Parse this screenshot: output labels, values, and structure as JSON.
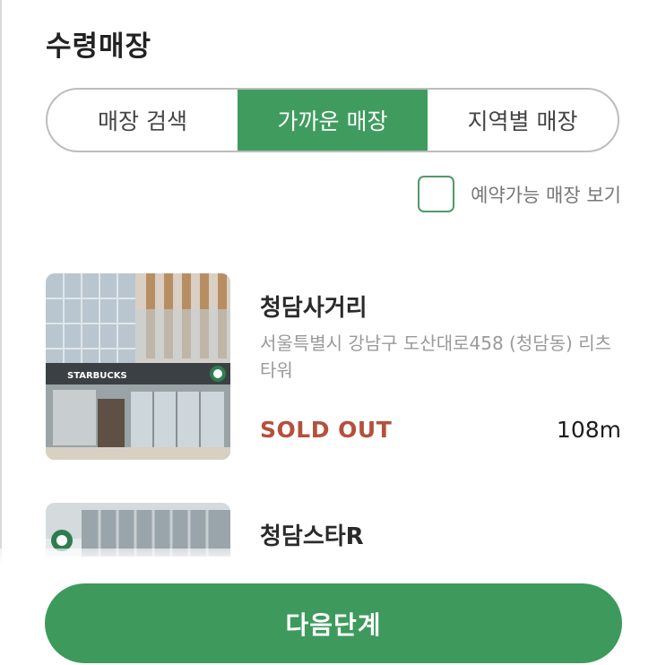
{
  "header": {
    "title": "수령매장"
  },
  "tabs": [
    {
      "label": "매장 검색",
      "active": false
    },
    {
      "label": "가까운 매장",
      "active": true
    },
    {
      "label": "지역별 매장",
      "active": false
    }
  ],
  "filter": {
    "label": "예약가능 매장 보기",
    "checked": false
  },
  "stores": [
    {
      "name": "청담사거리",
      "address": "서울특별시 강남구 도산대로458 (청담동) 리츠타워",
      "status": "SOLD OUT",
      "distance": "108m",
      "sign_text": "STARBUCKS"
    },
    {
      "name": "청담스타R"
    }
  ],
  "footer": {
    "next_label": "다음단계"
  },
  "colors": {
    "brand_green": "#3f9c5e",
    "sold_out": "#b5503c",
    "muted_text": "#9a9a9a"
  }
}
